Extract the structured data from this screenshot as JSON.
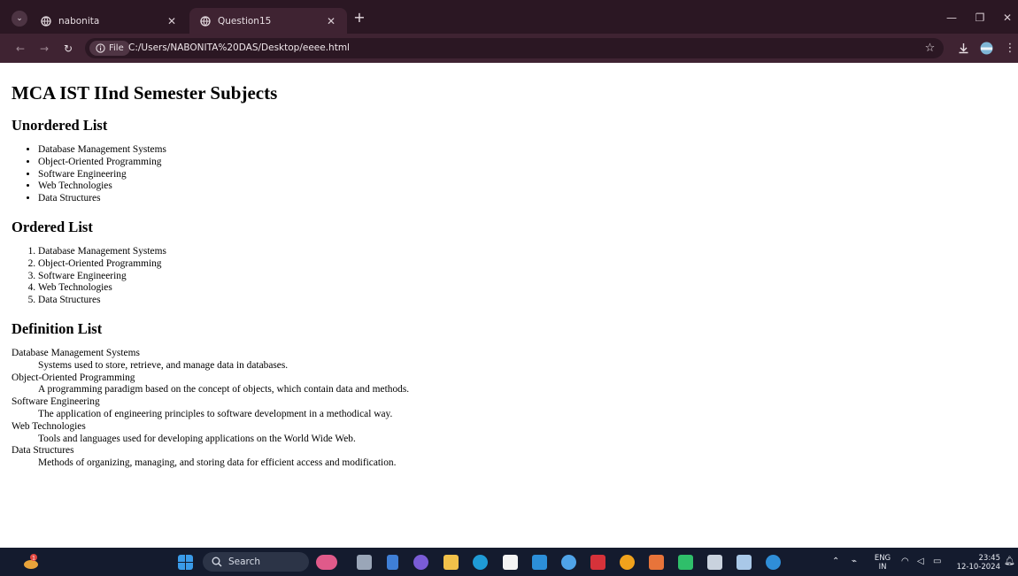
{
  "browser": {
    "tabs": [
      {
        "title": "nabonita",
        "active": false
      },
      {
        "title": "Question15",
        "active": true
      }
    ],
    "new_tab_label": "+",
    "site_chip": "File",
    "url": "C:/Users/NABONITA%20DAS/Desktop/eeee.html",
    "icons": [
      "tab-search-icon",
      "globe-icon",
      "close-icon",
      "plus-icon",
      "minimize-icon",
      "restore-icon",
      "back-icon",
      "forward-icon",
      "reload-icon",
      "info-icon",
      "star-icon",
      "download-icon",
      "profile-avatar",
      "more-icon"
    ]
  },
  "page": {
    "title": "MCA IST IInd Semester Subjects",
    "unordered": {
      "heading": "Unordered List",
      "items": [
        "Database Management Systems",
        "Object-Oriented Programming",
        "Software Engineering",
        "Web Technologies",
        "Data Structures"
      ]
    },
    "ordered": {
      "heading": "Ordered List",
      "items": [
        "Database Management Systems",
        "Object-Oriented Programming",
        "Software Engineering",
        "Web Technologies",
        "Data Structures"
      ]
    },
    "definition": {
      "heading": "Definition List",
      "items": [
        {
          "term": "Database Management Systems",
          "desc": "Systems used to store, retrieve, and manage data in databases."
        },
        {
          "term": "Object-Oriented Programming",
          "desc": "A programming paradigm based on the concept of objects, which contain data and methods."
        },
        {
          "term": "Software Engineering",
          "desc": "The application of engineering principles to software development in a methodical way."
        },
        {
          "term": "Web Technologies",
          "desc": "Tools and languages used for developing applications on the World Wide Web."
        },
        {
          "term": "Data Structures",
          "desc": "Methods of organizing, managing, and storing data for efficient access and modification."
        }
      ]
    }
  },
  "taskbar": {
    "search_label": "Search",
    "language": "ENG",
    "region": "IN",
    "time": "23:45",
    "date": "12-10-2024",
    "widget_badge": "1",
    "colors": {
      "background": "#141b2e",
      "windows_blue": "#3a8fd9"
    }
  },
  "colors": {
    "tabstrip": "#2b1723",
    "toolbar": "#3f2332",
    "omnibox": "#2b1723"
  }
}
